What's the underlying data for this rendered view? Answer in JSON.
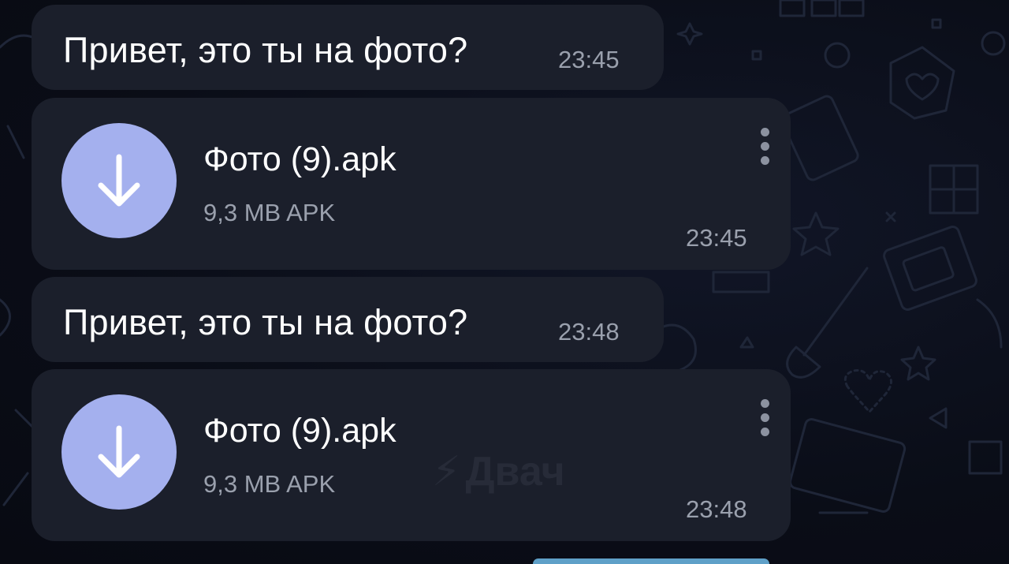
{
  "messages": [
    {
      "type": "text",
      "text": "Привет, это ты на фото?",
      "time": "23:45"
    },
    {
      "type": "file",
      "file_name": "Фото (9).apk",
      "file_meta": "9,3 MB APK",
      "time": "23:45",
      "icon": "download-arrow-icon"
    },
    {
      "type": "text",
      "text": "Привет, это ты на фото?",
      "time": "23:48"
    },
    {
      "type": "file",
      "file_name": "Фото (9).apk",
      "file_meta": "9,3 MB APK",
      "time": "23:48",
      "icon": "download-arrow-icon"
    }
  ],
  "watermark": {
    "text": "Двач"
  },
  "colors": {
    "background": "#0b0e18",
    "bubble": "#1b1f2b",
    "download_button": "#a4b0ee",
    "time_text": "#9aa0ad"
  }
}
